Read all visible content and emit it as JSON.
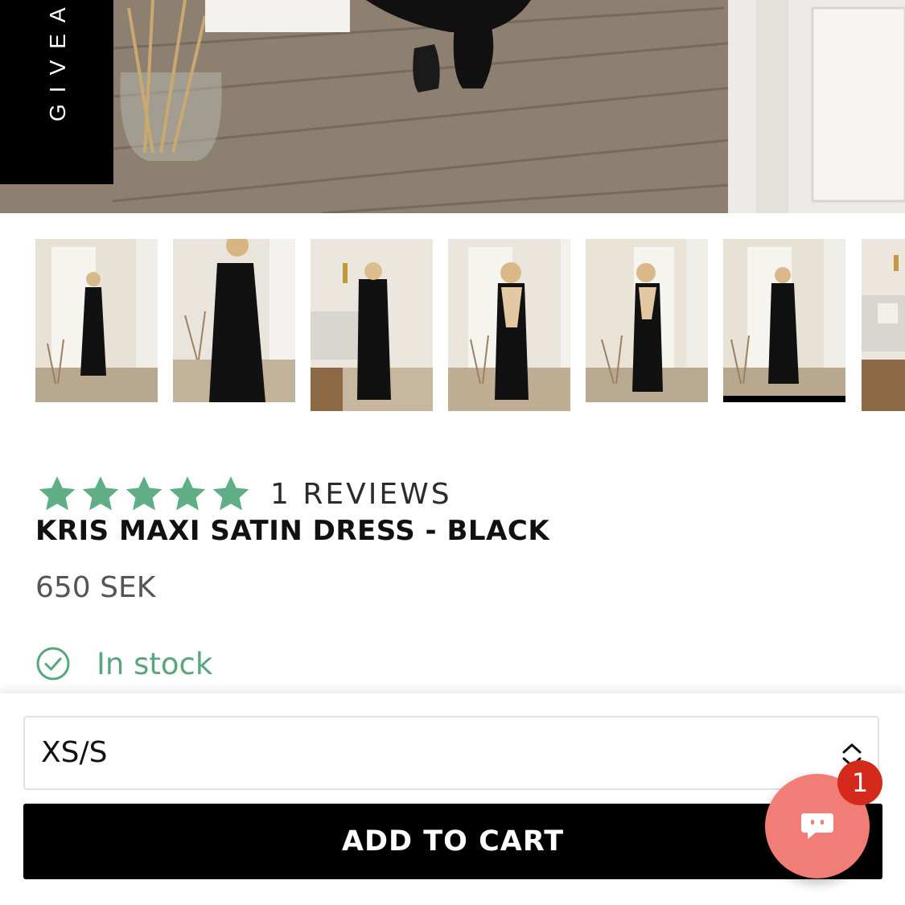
{
  "hero": {
    "giveaway_label": "GIVEAW"
  },
  "thumbnails": [
    {
      "name": "thumbnail-1",
      "active": false
    },
    {
      "name": "thumbnail-2",
      "active": false
    },
    {
      "name": "thumbnail-3",
      "active": false
    },
    {
      "name": "thumbnail-4",
      "active": false
    },
    {
      "name": "thumbnail-5",
      "active": false
    },
    {
      "name": "thumbnail-6",
      "active": true
    },
    {
      "name": "thumbnail-7",
      "active": false
    }
  ],
  "product": {
    "rating_stars": 5,
    "reviews_label": "1 REVIEWS",
    "title": "KRIS MAXI SATIN DRESS - BLACK",
    "price": "650 SEK",
    "stock_status": "In stock"
  },
  "cart": {
    "size_selected": "XS/S",
    "add_to_cart_label": "ADD TO CART"
  },
  "chat": {
    "badge_count": "1"
  },
  "colors": {
    "star": "#5fae85",
    "stock": "#5aa57c",
    "chat": "#f27d76",
    "badge": "#d32a1b",
    "button": "#000000"
  }
}
